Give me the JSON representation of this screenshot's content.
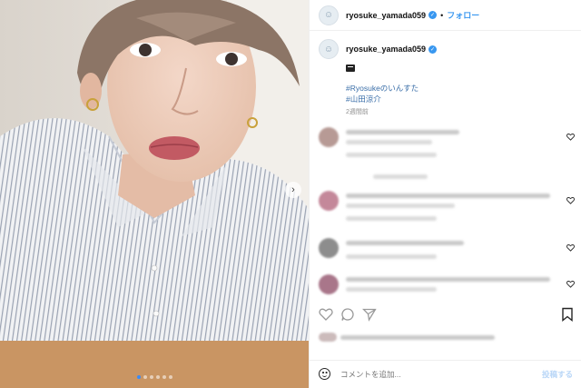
{
  "post": {
    "username": "ryosuke_yamada059",
    "follow_label": "フォロー",
    "separator": "•",
    "verified_mark": "✓",
    "caption": {
      "username": "ryosuke_yamada059",
      "emoji": "clapper-board-icon",
      "hashtags": [
        "#Ryosukeのいんすた",
        "#山田涼介"
      ],
      "time_ago": "2週間前"
    }
  },
  "comment_box": {
    "placeholder": "コメントを追加...",
    "post_label": "投稿する"
  },
  "photo": {
    "slide_count": 6,
    "active_slide": 1,
    "next_arrow": "›"
  },
  "colors": {
    "accent": "#3897f0",
    "hashtag": "#3a6ea8",
    "muted": "#8e8e8e"
  }
}
